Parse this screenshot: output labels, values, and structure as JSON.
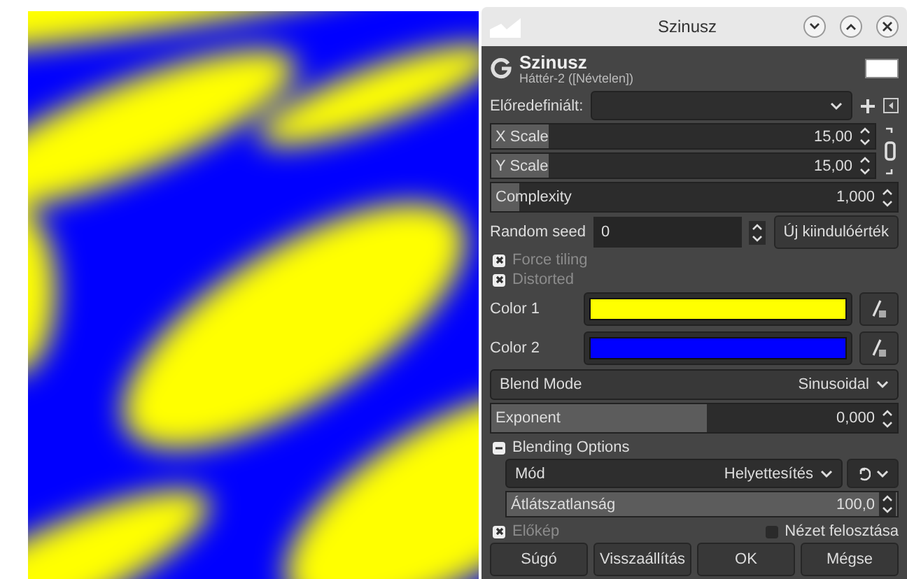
{
  "window": {
    "title": "Szinusz"
  },
  "header": {
    "title": "Szinusz",
    "subtitle": "Háttér-2 ([Névtelen])"
  },
  "presets": {
    "label": "Előredefiniált:"
  },
  "scales": [
    {
      "label": "X Scale",
      "value": "15,00",
      "level": 0.15
    },
    {
      "label": "Y Scale",
      "value": "15,00",
      "level": 0.15
    }
  ],
  "chain": {
    "linked": true
  },
  "complexity": {
    "label": "Complexity",
    "value": "1,000",
    "level": 0.07
  },
  "random_seed": {
    "label": "Random seed",
    "value": "0",
    "button": "Új kiindulóérték"
  },
  "options": [
    {
      "label": "Force tiling",
      "checked": true,
      "disabled": true
    },
    {
      "label": "Distorted",
      "checked": true,
      "disabled": true
    }
  ],
  "colors": [
    {
      "label": "Color 1",
      "color": "#ffff00"
    },
    {
      "label": "Color 2",
      "color": "#0000ff"
    }
  ],
  "blend_mode": {
    "label": "Blend Mode",
    "value": "Sinusoidal"
  },
  "exponent": {
    "label": "Exponent",
    "value": "0,000",
    "level": 0.53
  },
  "blending": {
    "label": "Blending Options",
    "expanded": true,
    "mode_label": "Mód",
    "mode_value": "Helyettesítés",
    "opacity": {
      "label": "Átlátszatlanság",
      "value": "100,0",
      "level": 1
    }
  },
  "preview": {
    "label": "Előkép",
    "checked": true,
    "disabled": true
  },
  "split_view": {
    "label": "Nézet felosztása",
    "checked": false
  },
  "buttons": [
    "Súgó",
    "Visszaállítás",
    "OK",
    "Mégse"
  ]
}
